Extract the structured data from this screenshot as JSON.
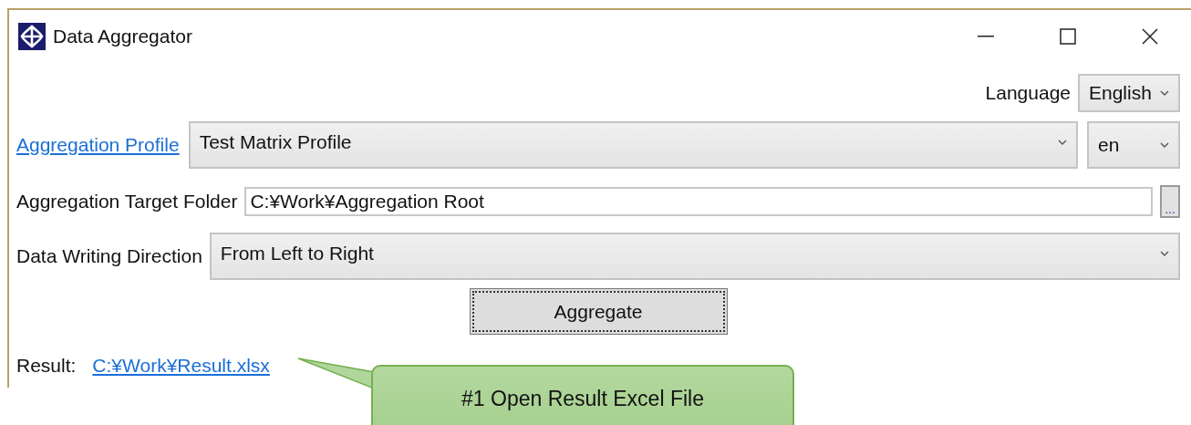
{
  "window": {
    "title": "Data Aggregator"
  },
  "language": {
    "label": "Language",
    "value": "English"
  },
  "profile": {
    "link": "Aggregation Profile",
    "value": "Test Matrix Profile",
    "locale": "en"
  },
  "target_folder": {
    "label": "Aggregation Target Folder",
    "value": "C:¥Work¥Aggregation Root",
    "browse": "..."
  },
  "direction": {
    "label": "Data Writing Direction",
    "value": "From Left to Right"
  },
  "aggregate_button": "Aggregate",
  "result": {
    "label": "Result:",
    "link": "C:¥Work¥Result.xlsx"
  },
  "callout": "#1 Open Result Excel File"
}
